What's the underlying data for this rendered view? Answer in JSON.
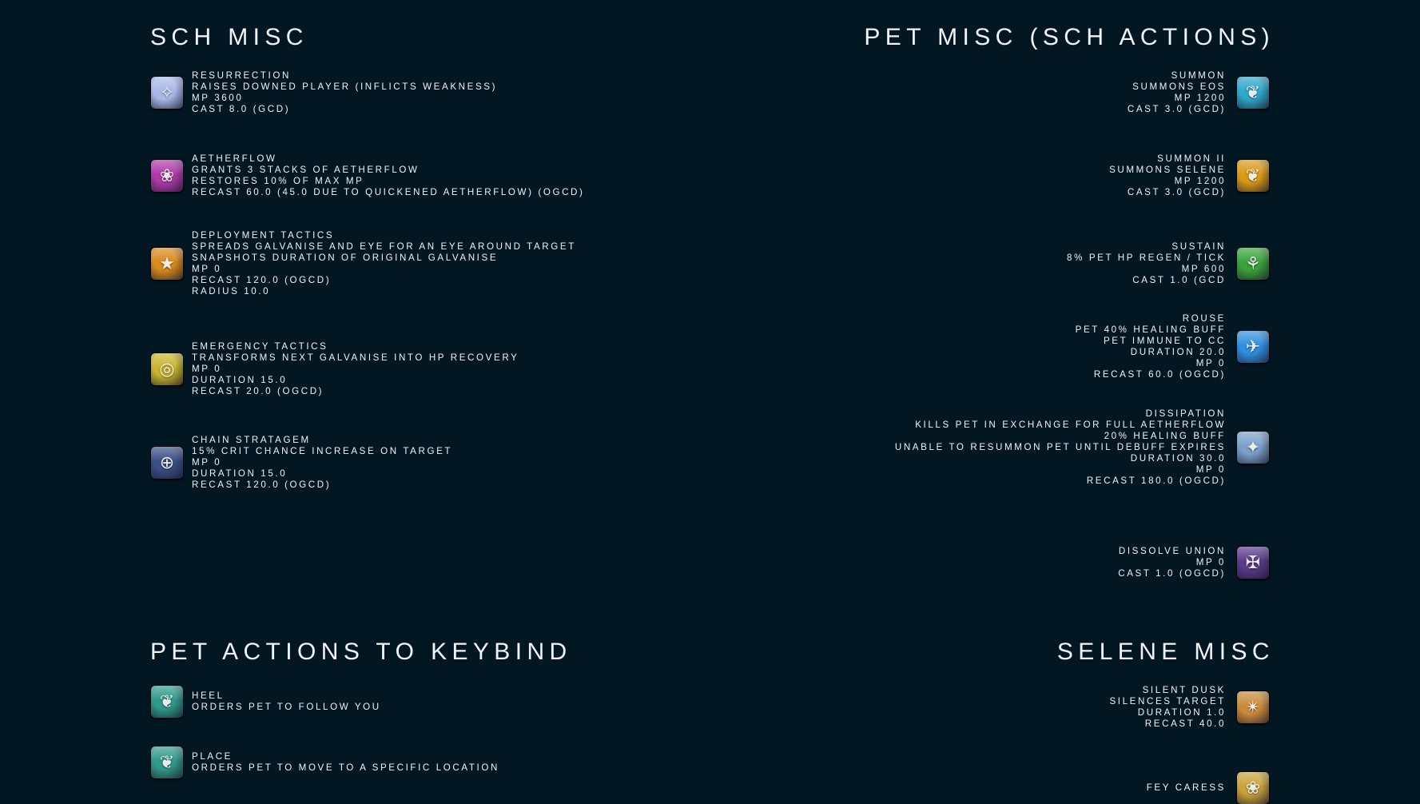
{
  "sections": {
    "sch_misc": "SCH MISC",
    "pet_misc": "PET MISC (SCH ACTIONS)",
    "pet_actions": "PET ACTIONS TO KEYBIND",
    "selene_misc": "SELENE MISC"
  },
  "sch_misc": [
    {
      "name": "RESURRECTION",
      "lines": [
        "RAISES DOWNED PLAYER (INFLICTS WEAKNESS)",
        "MP 3600",
        "CAST 8.0 (GCD)"
      ],
      "icon": "resurrection-icon",
      "color": "#a9b8e8"
    },
    {
      "name": "AETHERFLOW",
      "lines": [
        "GRANTS 3 STACKS OF AETHERFLOW",
        "RESTORES 10% OF MAX MP",
        "RECAST 60.0 (45.0 DUE TO QUICKENED AETHERFLOW) (OGCD)"
      ],
      "icon": "aetherflow-icon",
      "color": "#b03aa8"
    },
    {
      "name": "DEPLOYMENT TACTICS",
      "lines": [
        "SPREADS GALVANISE AND EYE FOR AN EYE AROUND TARGET",
        "SNAPSHOTS DURATION OF ORIGINAL GALVANISE",
        "MP 0",
        "RECAST 120.0 (OGCD)",
        "RADIUS 10.0"
      ],
      "icon": "deployment-tactics-icon",
      "color": "#d98a1c"
    },
    {
      "name": "EMERGENCY TACTICS",
      "lines": [
        "TRANSFORMS NEXT GALVANISE INTO HP RECOVERY",
        "MP 0",
        "DURATION 15.0",
        "RECAST 20.0 (OGCD)"
      ],
      "icon": "emergency-tactics-icon",
      "color": "#c9b52a"
    },
    {
      "name": "CHAIN STRATAGEM",
      "lines": [
        "15% CRIT CHANCE INCREASE ON TARGET",
        "MP 0",
        "DURATION 15.0",
        "RECAST 120.0 (OGCD)"
      ],
      "icon": "chain-stratagem-icon",
      "color": "#3a4f86"
    }
  ],
  "pet_misc": [
    {
      "name": "SUMMON",
      "lines": [
        "SUMMONS EOS",
        "MP 1200",
        "CAST 3.0 (GCD)"
      ],
      "icon": "summon-eos-icon",
      "color": "#2fa7c9"
    },
    {
      "name": "SUMMON II",
      "lines": [
        "SUMMONS SELENE",
        "MP 1200",
        "CAST 3.0 (GCD)"
      ],
      "icon": "summon-selene-icon",
      "color": "#d99a18"
    },
    {
      "name": "SUSTAIN",
      "lines": [
        "8% PET HP REGEN / TICK",
        "MP 600",
        "CAST 1.0 (GCD"
      ],
      "icon": "sustain-icon",
      "color": "#3aa23a"
    },
    {
      "name": "ROUSE",
      "lines": [
        "PET 40% HEALING BUFF",
        "PET IMMUNE TO CC",
        "DURATION 20.0",
        "MP 0",
        "RECAST 60.0 (OGCD)"
      ],
      "icon": "rouse-icon",
      "color": "#2f8fe0"
    },
    {
      "name": "DISSIPATION",
      "lines": [
        "KILLS PET IN EXCHANGE FOR FULL AETHERFLOW",
        "20% HEALING BUFF",
        "UNABLE TO RESUMMON PET UNTIL DEBUFF EXPIRES",
        "DURATION 30.0",
        "MP 0",
        "RECAST 180.0 (OGCD)"
      ],
      "icon": "dissipation-icon",
      "color": "#7aa0c8"
    },
    {
      "name": "DISSOLVE UNION",
      "lines": [
        "MP 0",
        "CAST 1.0 (OGCD)"
      ],
      "icon": "dissolve-union-icon",
      "color": "#5a3a8a"
    }
  ],
  "pet_actions": [
    {
      "name": "HEEL",
      "lines": [
        "ORDERS PET TO FOLLOW YOU"
      ],
      "icon": "heel-icon",
      "color": "#2f9a8a"
    },
    {
      "name": "PLACE",
      "lines": [
        "ORDERS PET TO MOVE TO A SPECIFIC LOCATION"
      ],
      "icon": "place-icon",
      "color": "#2f9a8a"
    }
  ],
  "selene_misc": [
    {
      "name": "SILENT DUSK",
      "lines": [
        "SILENCES TARGET",
        "DURATION 1.0",
        "RECAST 40.0"
      ],
      "icon": "silent-dusk-icon",
      "color": "#c98a3a"
    },
    {
      "name": "FEY CARESS",
      "lines": [],
      "icon": "fey-caress-icon",
      "color": "#c9a23a"
    }
  ]
}
